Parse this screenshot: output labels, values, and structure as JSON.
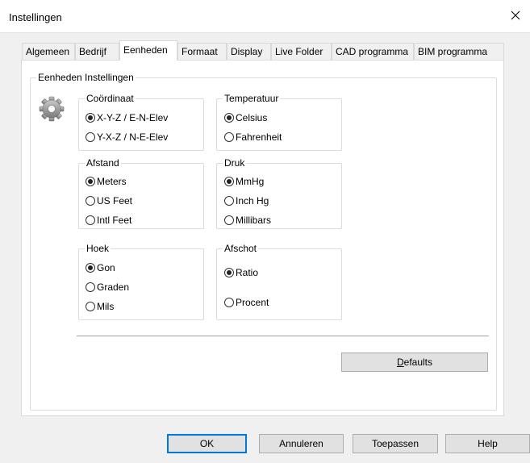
{
  "window": {
    "title": "Instellingen",
    "close_glyph": "✕"
  },
  "tabs": [
    {
      "label": "Algemeen",
      "active": false
    },
    {
      "label": "Bedrijf",
      "active": false
    },
    {
      "label": "Eenheden",
      "active": true
    },
    {
      "label": "Formaat",
      "active": false
    },
    {
      "label": "Display",
      "active": false
    },
    {
      "label": "Live Folder",
      "active": false
    },
    {
      "label": "CAD programma",
      "active": false
    },
    {
      "label": "BIM programma",
      "active": false
    }
  ],
  "panel": {
    "group_title": "Eenheden Instellingen",
    "icon": "gear-icon",
    "groups": {
      "coordinaat": {
        "title": "Coördinaat",
        "options": [
          {
            "label": "X-Y-Z / E-N-Elev",
            "selected": true
          },
          {
            "label": "Y-X-Z / N-E-Elev",
            "selected": false
          }
        ]
      },
      "temperatuur": {
        "title": "Temperatuur",
        "options": [
          {
            "label": "Celsius",
            "selected": true
          },
          {
            "label": "Fahrenheit",
            "selected": false
          }
        ]
      },
      "afstand": {
        "title": "Afstand",
        "options": [
          {
            "label": "Meters",
            "selected": true
          },
          {
            "label": "US Feet",
            "selected": false
          },
          {
            "label": "Intl Feet",
            "selected": false
          }
        ]
      },
      "druk": {
        "title": "Druk",
        "options": [
          {
            "label": "MmHg",
            "selected": true
          },
          {
            "label": "Inch Hg",
            "selected": false
          },
          {
            "label": "Millibars",
            "selected": false
          }
        ]
      },
      "hoek": {
        "title": "Hoek",
        "options": [
          {
            "label": "Gon",
            "selected": true
          },
          {
            "label": "Graden",
            "selected": false
          },
          {
            "label": "Mils",
            "selected": false
          }
        ]
      },
      "afschot": {
        "title": "Afschot",
        "options": [
          {
            "label": "Ratio",
            "selected": true
          },
          {
            "label": "Procent",
            "selected": false
          }
        ]
      }
    },
    "defaults_button": {
      "accel": "D",
      "rest": "efaults"
    }
  },
  "buttons": {
    "ok": "OK",
    "cancel": "Annuleren",
    "apply": "Toepassen",
    "help": "Help"
  },
  "colors": {
    "window_bg": "#f0f0f0",
    "panel_bg": "#ffffff",
    "default_button_border": "#0078d7"
  }
}
